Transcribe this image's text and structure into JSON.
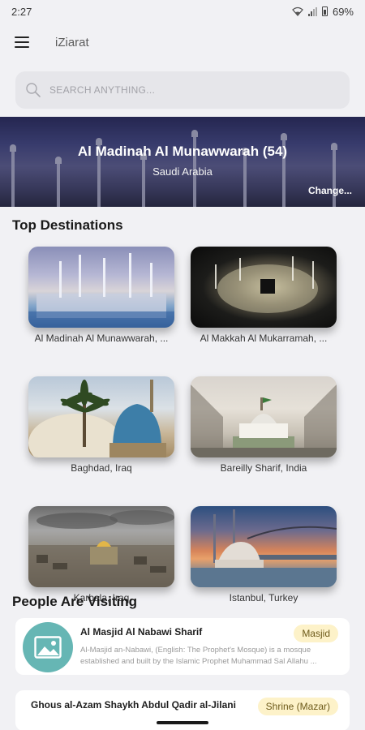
{
  "status_bar": {
    "time": "2:27",
    "battery": "69%"
  },
  "app_bar": {
    "title": "iZiarat",
    "menu_icon": "hamburger-menu-icon"
  },
  "search": {
    "placeholder": "SEARCH ANYTHING..."
  },
  "hero": {
    "title": "Al Madinah Al Munawwarah (54)",
    "subtitle": "Saudi Arabia",
    "change_label": "Change..."
  },
  "top_destinations": {
    "heading": "Top Destinations",
    "items": [
      {
        "label": "Al Madinah Al Munawwarah, ..."
      },
      {
        "label": "Al Makkah Al Mukarramah, ..."
      },
      {
        "label": "Baghdad, Iraq"
      },
      {
        "label": "Bareilly Sharif, India"
      },
      {
        "label": "Karbala, Iraq"
      },
      {
        "label": "Istanbul, Turkey"
      }
    ]
  },
  "people_visiting": {
    "heading": "People Are Visiting",
    "items": [
      {
        "title": "Al Masjid Al Nabawi Sharif",
        "badge": "Masjid",
        "description": "Al-Masjid an-Nabawi, (English: The Prophet's Mosque) is a mosque established and built by the Islamic Prophet Muhammad Sal Allahu ..."
      },
      {
        "title": "Ghous al-Azam Shaykh Abdul Qadir al-Jilani",
        "badge": "Shrine (Mazar)"
      }
    ]
  },
  "colors": {
    "background": "#f1f1f4",
    "badge_bg": "#fdf2c9",
    "thumb_teal": "#66b6b4"
  }
}
